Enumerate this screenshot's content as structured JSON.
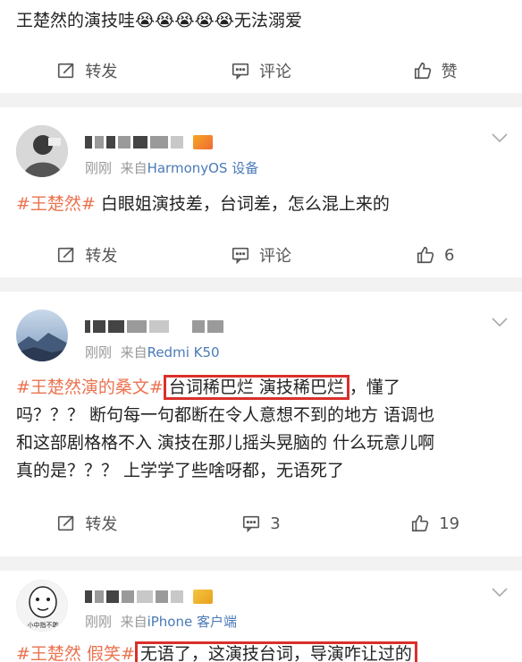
{
  "post0": {
    "text_main": "王楚然的演技哇",
    "emojis": [
      "😭",
      "😭",
      "😭",
      "😭",
      "😭"
    ],
    "text_tail": "无法溺爱",
    "actions": {
      "repost": "转发",
      "comment": "评论",
      "like": "赞"
    }
  },
  "post1": {
    "time": "刚刚",
    "from_prefix": "来自",
    "source": "HarmonyOS 设备",
    "hashtag": "#王楚然#",
    "body": "白眼姐演技差，台词差，怎么混上来的",
    "actions": {
      "repost": "转发",
      "comment": "评论",
      "like": "6"
    }
  },
  "post2": {
    "time": "刚刚",
    "from_prefix": "来自",
    "source": "Redmi K50",
    "hashtag": "#王楚然演的桑文#",
    "boxed": "台词稀巴烂 演技稀巴烂",
    "line1_tail": "，懂了",
    "line2": "吗？？？ 断句每一句都断在令人意想不到的地方 语调也",
    "line3": "和这部剧格格不入 演技在那儿摇头晃脑的 什么玩意儿啊",
    "line4": "真的是？？？ 上学学了些啥呀都，无语死了",
    "actions": {
      "repost": "转发",
      "comment": "3",
      "like": "19"
    }
  },
  "post3": {
    "avatar_text": "小中指不敢",
    "time": "刚刚",
    "from_prefix": "来自",
    "source": "iPhone 客户端",
    "hashtag": "#王楚然 假笑#",
    "boxed": "无语了，这演技台词，导演咋让过的"
  },
  "colors": {
    "accent": "#eb7350",
    "source_link": "#4a7ab7",
    "highlight_box": "#d9302c"
  },
  "icons": {
    "repost": "share-icon",
    "comment": "comment-icon",
    "like": "thumbs-up-icon",
    "expand": "chevron-down-icon"
  }
}
